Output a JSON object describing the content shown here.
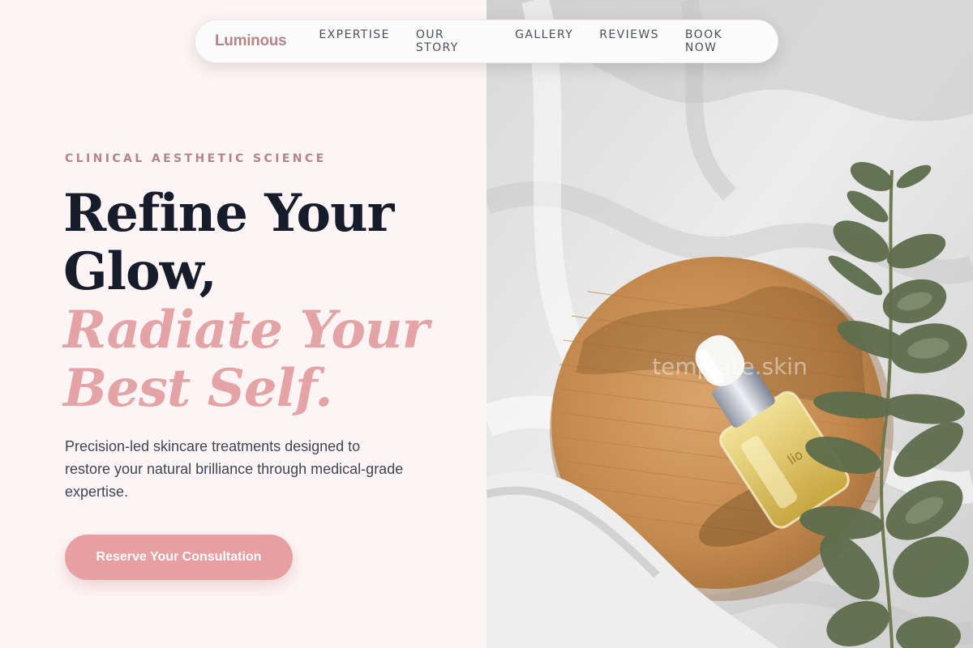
{
  "nav": {
    "brand": "Luminous",
    "links": [
      "EXPERTISE",
      "OUR STORY",
      "GALLERY",
      "REVIEWS",
      "BOOK NOW"
    ]
  },
  "hero": {
    "eyebrow": "CLINICAL AESTHETIC SCIENCE",
    "headline_lines": [
      "Refine Your",
      "Glow,"
    ],
    "accent_lines": [
      "Radiate Your",
      "Best Self."
    ],
    "description": "Precision-led skincare treatments designed to restore your natural brilliance through medical-grade expertise.",
    "cta_label": "Reserve Your Consultation"
  },
  "image": {
    "watermark": "template.skin",
    "bottle_label": "lio"
  },
  "colors": {
    "brand": "#b5848a",
    "accent": "#e4a4a6",
    "cta": "#e6a0a2",
    "background": "#fdf5f5",
    "heading": "#171c2b"
  }
}
